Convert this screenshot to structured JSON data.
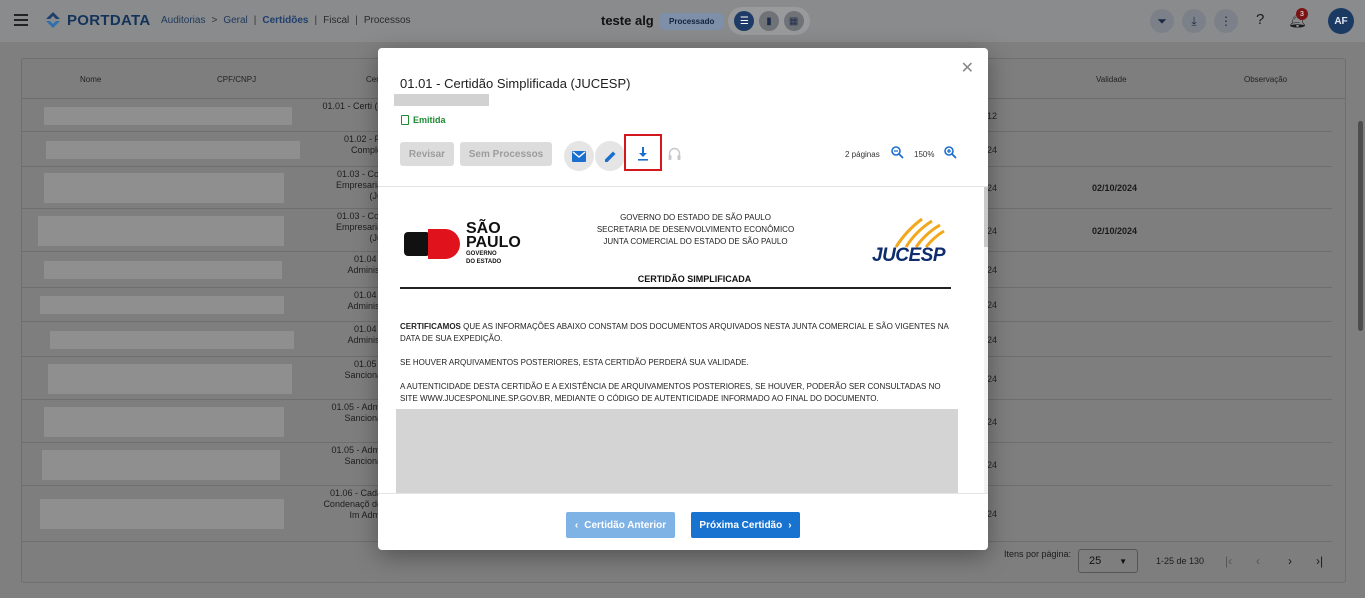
{
  "topbar": {
    "brand": "PORTDATA",
    "breadcrumb": [
      "Auditorias",
      ">",
      "Geral",
      "|",
      "Certidões",
      "|",
      "Fiscal",
      "|",
      "Processos"
    ],
    "project_name": "teste alg",
    "project_status": "Processado",
    "notification_count": "3",
    "avatar_initials": "AF"
  },
  "table": {
    "columns": [
      "Nome",
      "CPF/CNPJ",
      "Cer",
      "Validade",
      "Observação"
    ],
    "rows": [
      {
        "cert": "01.01 - Certi (J",
        "year": "12",
        "validade": ""
      },
      {
        "cert": "01.02 - Fi Comple",
        "year": "24",
        "validade": ""
      },
      {
        "cert": "01.03 - Cor Empresaria (Ju",
        "year": "24",
        "validade": "02/10/2024"
      },
      {
        "cert": "01.03 - Cor Empresaria (Ju",
        "year": "24",
        "validade": "02/10/2024"
      },
      {
        "cert": "01.04 - Administ",
        "year": "24",
        "validade": ""
      },
      {
        "cert": "01.04 - Administ",
        "year": "24",
        "validade": ""
      },
      {
        "cert": "01.04 - Administ",
        "year": "24",
        "validade": ""
      },
      {
        "cert": "01.05 - Sanciona",
        "year": "24",
        "validade": ""
      },
      {
        "cert": "01.05 - Admi Sanciona",
        "year": "24",
        "validade": ""
      },
      {
        "cert": "01.05 - Admi Sanciona",
        "year": "24",
        "validade": ""
      },
      {
        "cert": "01.06 - Cada Condenaçõ de Im Admi",
        "year": "24",
        "validade": ""
      }
    ],
    "pager": {
      "per_page_label": "Itens por página:",
      "per_page": "25",
      "range": "1-25 de 130"
    }
  },
  "modal": {
    "title": "01.01 - Certidão Simplificada (JUCESP)",
    "status": "Emitida",
    "buttons": {
      "revisar": "Revisar",
      "sem_processos": "Sem Processos",
      "prev": "Certidão Anterior",
      "next": "Próxima Certidão"
    },
    "pages": "2 páginas",
    "zoom": "150%",
    "document": {
      "sp_logo_line1": "SÃO",
      "sp_logo_line2": "PAULO",
      "sp_logo_line3": "GOVERNO",
      "sp_logo_line4": "DO ESTADO",
      "header_lines": [
        "GOVERNO DO ESTADO DE SÃO PAULO",
        "SECRETARIA DE DESENVOLVIMENTO ECONÔMICO",
        "JUNTA COMERCIAL DO ESTADO DE SÃO PAULO"
      ],
      "jucesp_logo": "JUCESP",
      "title": "CERTIDÃO SIMPLIFICADA",
      "p1_bold": "CERTIFICAMOS",
      "p1_rest": " QUE AS INFORMAÇÕES ABAIXO CONSTAM DOS DOCUMENTOS ARQUIVADOS NESTA JUNTA COMERCIAL E SÃO VIGENTES NA DATA DE SUA EXPEDIÇÃO.",
      "p2": "SE HOUVER ARQUIVAMENTOS POSTERIORES, ESTA CERTIDÃO PERDERÁ SUA VALIDADE.",
      "p3": "A AUTENTICIDADE DESTA CERTIDÃO E A EXISTÊNCIA DE ARQUIVAMENTOS POSTERIORES, SE HOUVER, PODERÃO SER CONSULTADAS NO SITE WWW.JUCESPONLINE.SP.GOV.BR, MEDIANTE O CÓDIGO DE AUTENTICIDADE INFORMADO AO FINAL DO DOCUMENTO."
    }
  },
  "colors": {
    "primary": "#1872d0",
    "highlight": "#d3181d",
    "emitida": "#1e8c34",
    "overlay": "#7f7f7f"
  }
}
